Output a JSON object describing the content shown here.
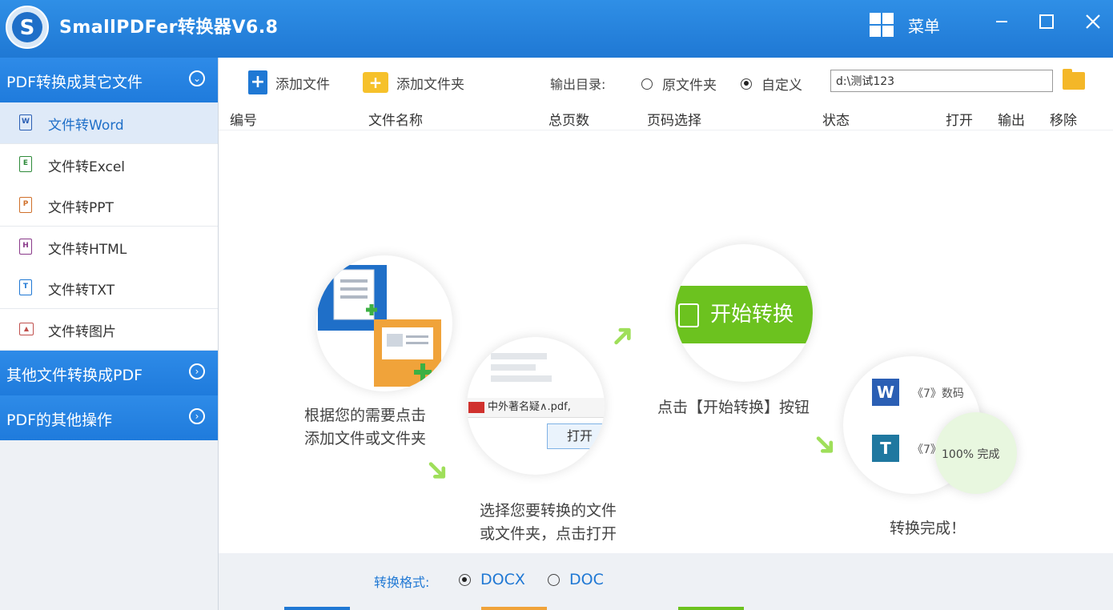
{
  "app": {
    "title": "SmallPDFer转换器V6.8",
    "menu_label": "菜单"
  },
  "sidebar": {
    "section_pdf_to_other": "PDF转换成其它文件",
    "items": [
      {
        "label": "文件转Word",
        "icon": "word-file-icon",
        "glyph": "W"
      },
      {
        "label": "文件转Excel",
        "icon": "excel-file-icon",
        "glyph": "E"
      },
      {
        "label": "文件转PPT",
        "icon": "ppt-file-icon",
        "glyph": "P"
      },
      {
        "label": "文件转HTML",
        "icon": "html-file-icon",
        "glyph": "H"
      },
      {
        "label": "文件转TXT",
        "icon": "txt-file-icon",
        "glyph": "T"
      },
      {
        "label": "文件转图片",
        "icon": "image-file-icon",
        "glyph": "▲"
      }
    ],
    "section_other_to_pdf": "其他文件转换成PDF",
    "section_pdf_ops": "PDF的其他操作"
  },
  "toolbar": {
    "add_file": "添加文件",
    "add_folder": "添加文件夹",
    "output_label": "输出目录:",
    "radio_original": "原文件夹",
    "radio_custom": "自定义",
    "path_value": "d:\\测试123"
  },
  "table": {
    "headers": [
      "编号",
      "文件名称",
      "总页数",
      "页码选择",
      "状态",
      "打开",
      "输出",
      "移除"
    ]
  },
  "guide": {
    "step1_line1": "根据您的需要点击",
    "step1_line2": "添加文件或文件夹",
    "step2_line1": "选择您要转换的文件",
    "step2_line2": "或文件夹，点击打开",
    "step2_file": "中外著名疑∧.pdf,",
    "step2_open": "打开",
    "step3_text": "点击【开始转换】按钮",
    "step3_button": "开始转换",
    "step4_text": "转换完成！",
    "step4_row1": "《7》数码",
    "step4_row2": "《7》",
    "step4_progress": "100% 完成"
  },
  "bottom": {
    "format_label": "转换格式:",
    "opt_docx": "DOCX",
    "opt_doc": "DOC"
  },
  "colors": {
    "brand": "#1f78d4",
    "accent_green": "#6cc21f",
    "folder": "#f4b728"
  }
}
